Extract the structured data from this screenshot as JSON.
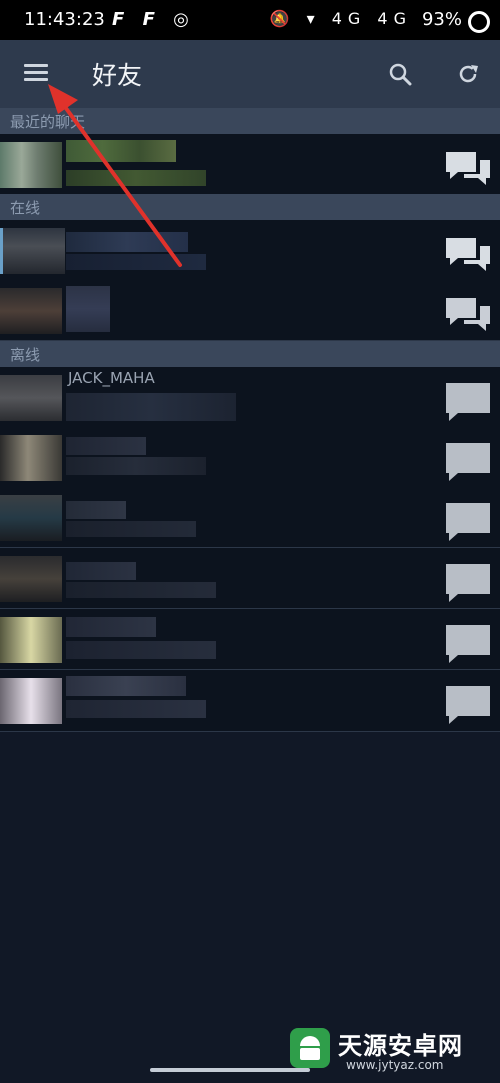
{
  "status_bar": {
    "time": "11:43:23",
    "app_icons": "𝙁 𝙁 ◎",
    "right_icons": "🔕 ▾ 4G 4G",
    "battery": "93%"
  },
  "app_bar": {
    "title": "好友",
    "menu_icon": "menu-icon",
    "search_icon": "search-icon",
    "refresh_icon": "refresh-icon"
  },
  "sections": {
    "recent": "最近的聊天",
    "online": "在线",
    "offline": "离线"
  },
  "offline_first_name": "JACK_MAHA",
  "watermark": {
    "brand": "天源安卓网",
    "url": "www.jytyaz.com"
  },
  "colors": {
    "app_bar": "#2e3a4d",
    "section_header": "#3a475b",
    "row_bg": "#0c131e",
    "annotation_arrow": "#e0322b"
  }
}
